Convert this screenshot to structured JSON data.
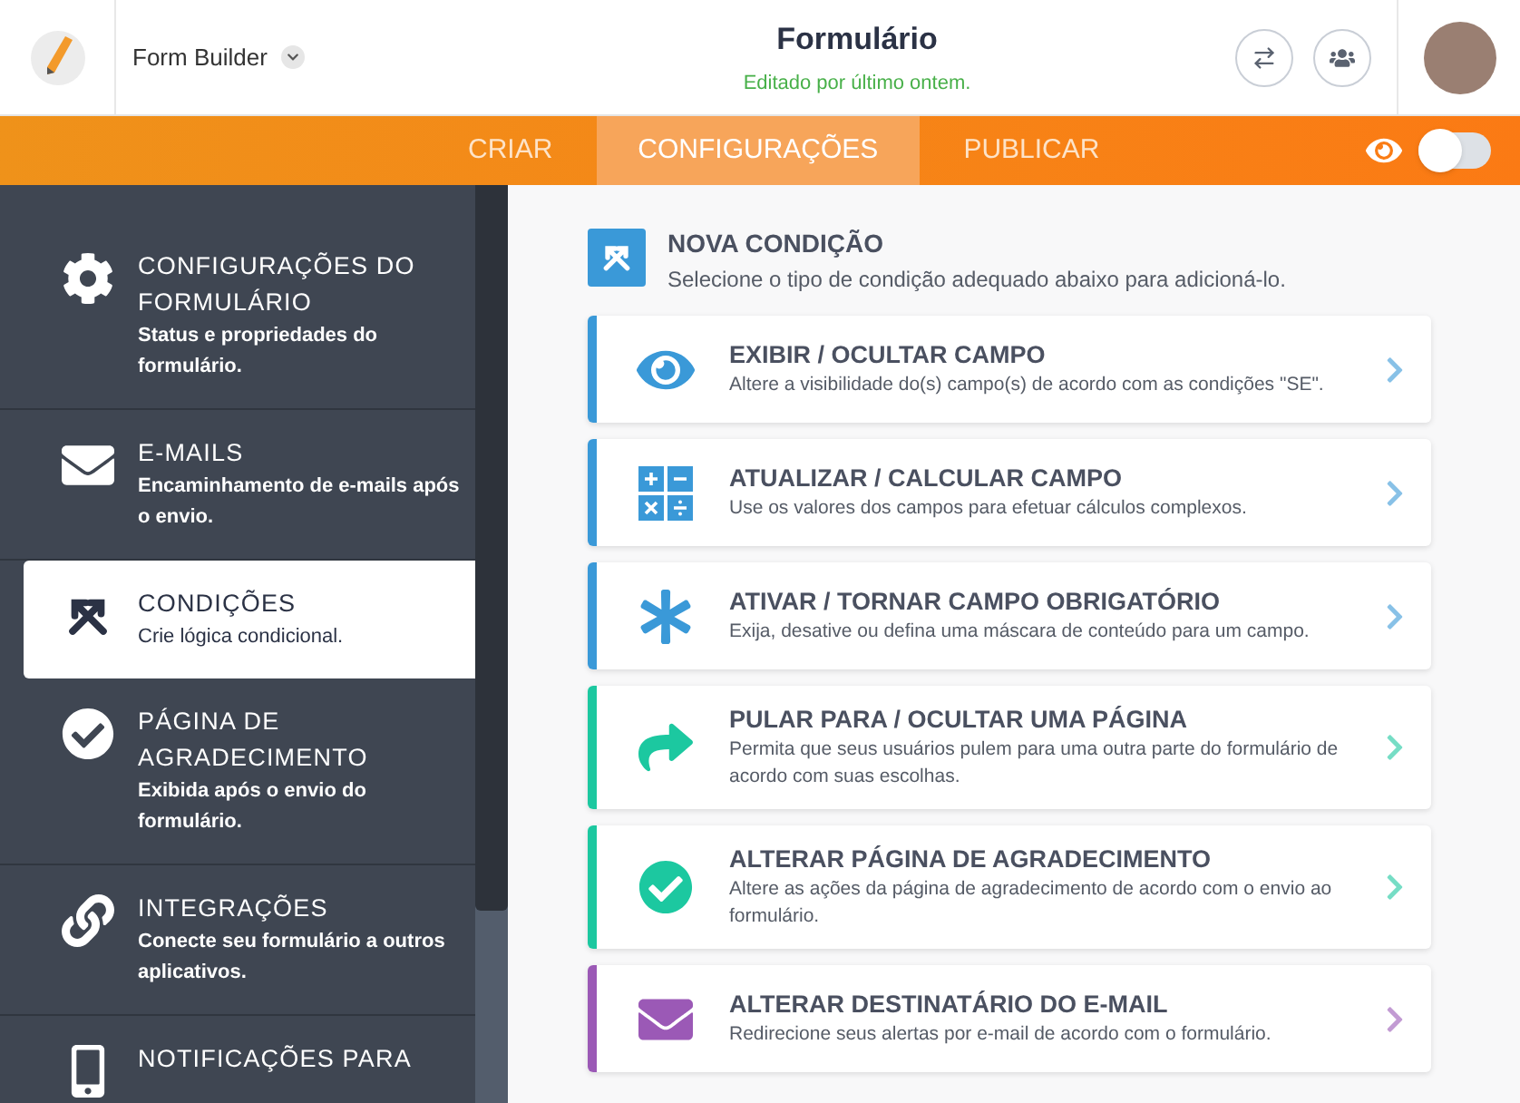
{
  "header": {
    "app_name": "Form Builder",
    "title": "Formulário",
    "subtitle": "Editado por último ontem."
  },
  "nav": {
    "tabs": [
      {
        "label": "CRIAR",
        "selected": false
      },
      {
        "label": "CONFIGURAÇÕES",
        "selected": true
      },
      {
        "label": "PUBLICAR",
        "selected": false
      }
    ],
    "preview_toggle": {
      "on": false
    }
  },
  "sidebar": {
    "items": [
      {
        "kind": "settings",
        "title": "CONFIGURAÇÕES DO FORMULÁRIO",
        "description": "Status e propriedades do formulário.",
        "selected": false
      },
      {
        "kind": "emails",
        "title": "E-MAILS",
        "description": "Encaminhamento de e-mails após o envio.",
        "selected": false
      },
      {
        "kind": "conditions",
        "title": "CONDIÇÕES",
        "description": "Crie lógica condicional.",
        "selected": true
      },
      {
        "kind": "thankyou",
        "title": "PÁGINA DE AGRADECIMENTO",
        "description": "Exibida após o envio do formulário.",
        "selected": false
      },
      {
        "kind": "integrations",
        "title": "INTEGRAÇÕES",
        "description": "Conecte seu formulário a outros aplicativos.",
        "selected": false
      },
      {
        "kind": "mobile",
        "title": "NOTIFICAÇÕES PARA",
        "selected": false
      }
    ]
  },
  "main": {
    "heading": "NOVA CONDIÇÃO",
    "subheading": "Selecione o tipo de condição adequado abaixo para adicioná-lo.",
    "conditions": [
      {
        "kind": "show_hide",
        "title": "EXIBIR / OCULTAR CAMPO",
        "description": "Altere a visibilidade do(s) campo(s) de acordo com as condições \"SE\".",
        "color": "#3a99d8"
      },
      {
        "kind": "calculate",
        "title": "ATUALIZAR / CALCULAR CAMPO",
        "description": "Use os valores dos campos para efetuar cálculos complexos.",
        "color": "#3a99d8"
      },
      {
        "kind": "require",
        "title": "ATIVAR / TORNAR CAMPO OBRIGATÓRIO",
        "description": "Exija, desative ou defina uma máscara de conteúdo para um campo.",
        "color": "#3a99d8"
      },
      {
        "kind": "skip",
        "title": "PULAR PARA / OCULTAR UMA PÁGINA",
        "description": "Permita que seus usuários pulem para uma outra parte do formulário de acordo com suas escolhas.",
        "color": "#1cc8a0"
      },
      {
        "kind": "thankyou",
        "title": "ALTERAR PÁGINA DE AGRADECIMENTO",
        "description": "Altere as ações da página de agradecimento de acordo com o envio ao formulário.",
        "color": "#1cc8a0"
      },
      {
        "kind": "email",
        "title": "ALTERAR DESTINATÁRIO DO E-MAIL",
        "description": "Redirecione seus alertas por e-mail de acordo com o formulário.",
        "color": "#9b59b6"
      }
    ]
  }
}
